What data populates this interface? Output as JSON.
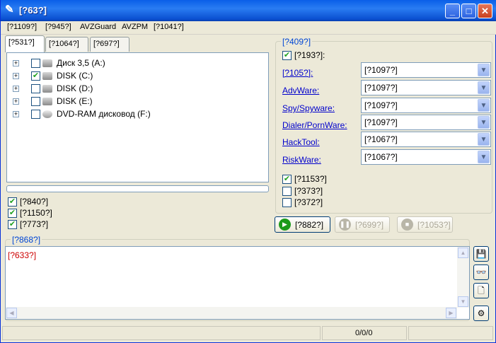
{
  "window": {
    "title": "[?63?]"
  },
  "menu": [
    {
      "label": "[?1109?]"
    },
    {
      "label": "[?945?]"
    },
    {
      "label": "AVZGuard"
    },
    {
      "label": "AVZPM"
    },
    {
      "label": "[?1041?]"
    }
  ],
  "tabs": [
    {
      "label": "[?531?]"
    },
    {
      "label": "[?1064?]"
    },
    {
      "label": "[?697?]"
    }
  ],
  "tree": [
    {
      "label": "Диск 3,5 (A:)",
      "checked": false
    },
    {
      "label": "DISK (C:)",
      "checked": true
    },
    {
      "label": "DISK (D:)",
      "checked": false
    },
    {
      "label": "DISK (E:)",
      "checked": false
    },
    {
      "label": "DVD-RAM дисковод (F:)",
      "checked": false
    }
  ],
  "left_checks": [
    {
      "label": "[?840?]",
      "checked": true
    },
    {
      "label": "[?1150?]",
      "checked": true
    },
    {
      "label": "[?773?]",
      "checked": true
    }
  ],
  "group": {
    "title": "[?409?]",
    "main_check": {
      "label": "[?193?]:",
      "checked": true
    },
    "rows": [
      {
        "label": "[?105?]:",
        "value": "[?1097?]"
      },
      {
        "label": "AdvWare:",
        "value": "[?1097?]"
      },
      {
        "label": "Spy/Spyware:",
        "value": "[?1097?]"
      },
      {
        "label": "Dialer/PornWare:",
        "value": "[?1097?]"
      },
      {
        "label": "HackTool:",
        "value": "[?1067?]"
      },
      {
        "label": "RiskWare:",
        "value": "[?1067?]"
      }
    ],
    "checks": [
      {
        "label": "[?1153?]",
        "checked": true
      },
      {
        "label": "[?373?]",
        "checked": false
      },
      {
        "label": "[?372?]",
        "checked": false
      }
    ]
  },
  "buttons": {
    "start": "[?882?]",
    "pause": "[?699?]",
    "stop": "[?1053?]"
  },
  "log": {
    "title": "[?868?]",
    "text": "[?633?]"
  },
  "status": {
    "counter": "0/0/0"
  },
  "colors": {
    "accent": "#0a5fe8",
    "link": "#0000cc",
    "log_text": "#cc0000",
    "check": "#21a121"
  }
}
